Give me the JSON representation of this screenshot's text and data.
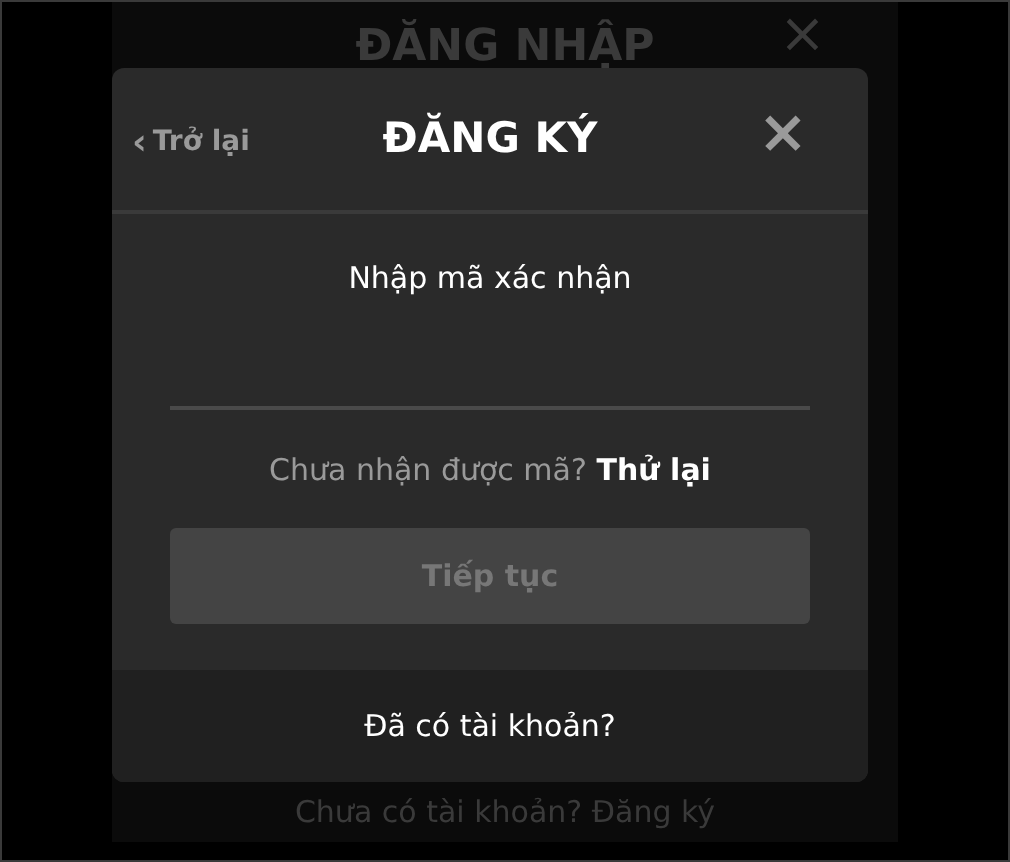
{
  "background_dialog": {
    "title": "ĐĂNG NHẬP",
    "close": "×",
    "footer_text": "Chưa có tài khoản? Đăng ký"
  },
  "dialog": {
    "back_link": {
      "icon": "‹",
      "label": "Trở lại"
    },
    "title": "ĐĂNG KÝ",
    "close": "×",
    "prompt": "Nhập mã xác nhận",
    "resend": {
      "text": "Chưa nhận được mã?",
      "link": "Thử lại"
    },
    "continue_button": {
      "label": "Tiếp tục",
      "disabled": true
    },
    "footer_link": "Đã có tài khoản?"
  }
}
